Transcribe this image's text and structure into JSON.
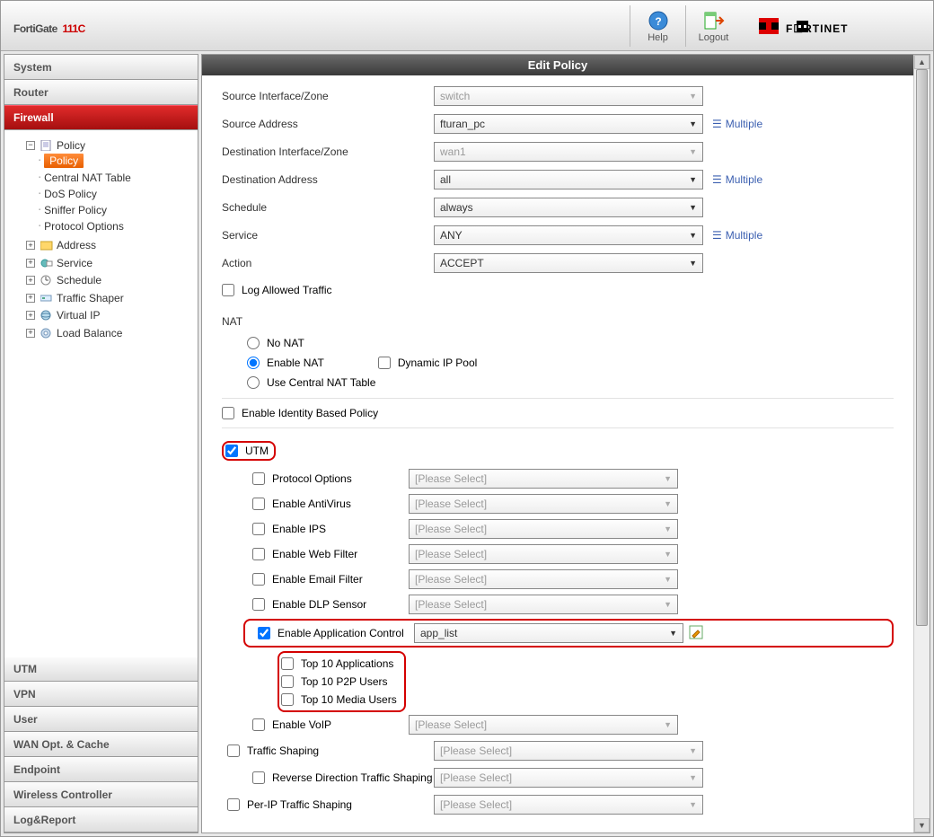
{
  "header": {
    "product": "FortiGate",
    "model": "111C",
    "help": "Help",
    "logout": "Logout",
    "brand": "FORTINET"
  },
  "sidebar": {
    "system": "System",
    "router": "Router",
    "firewall": "Firewall",
    "utm": "UTM",
    "vpn": "VPN",
    "user": "User",
    "wanopt": "WAN Opt. & Cache",
    "endpoint": "Endpoint",
    "wireless": "Wireless Controller",
    "logreport": "Log&Report",
    "tree": {
      "policy": "Policy",
      "policy_sub": "Policy",
      "central_nat": "Central NAT Table",
      "dos": "DoS Policy",
      "sniffer": "Sniffer Policy",
      "protoopt": "Protocol Options",
      "address": "Address",
      "service": "Service",
      "schedule": "Schedule",
      "shaper": "Traffic Shaper",
      "vip": "Virtual IP",
      "lb": "Load Balance"
    }
  },
  "page": {
    "title": "Edit Policy",
    "src_if": "Source Interface/Zone",
    "src_if_val": "switch",
    "src_addr": "Source Address",
    "src_addr_val": "fturan_pc",
    "dst_if": "Destination Interface/Zone",
    "dst_if_val": "wan1",
    "dst_addr": "Destination Address",
    "dst_addr_val": "all",
    "schedule": "Schedule",
    "schedule_val": "always",
    "service": "Service",
    "service_val": "ANY",
    "action": "Action",
    "action_val": "ACCEPT",
    "multiple": "Multiple",
    "log_allowed": "Log Allowed Traffic",
    "nat": "NAT",
    "no_nat": "No NAT",
    "enable_nat": "Enable NAT",
    "dyn_pool": "Dynamic IP Pool",
    "central_nat": "Use Central NAT Table",
    "identity": "Enable Identity Based Policy",
    "utm": "UTM",
    "please_select": "[Please Select]",
    "proto_opt": "Protocol Options",
    "enable_av": "Enable AntiVirus",
    "enable_ips": "Enable IPS",
    "enable_wf": "Enable Web Filter",
    "enable_ef": "Enable Email Filter",
    "enable_dlp": "Enable DLP Sensor",
    "enable_app": "Enable Application Control",
    "app_list": "app_list",
    "top_apps": "Top 10 Applications",
    "top_p2p": "Top 10 P2P Users",
    "top_media": "Top 10 Media Users",
    "enable_voip": "Enable VoIP",
    "traffic_shaping": "Traffic Shaping",
    "reverse_ts": "Reverse Direction Traffic Shaping",
    "perip_ts": "Per-IP Traffic Shaping"
  }
}
